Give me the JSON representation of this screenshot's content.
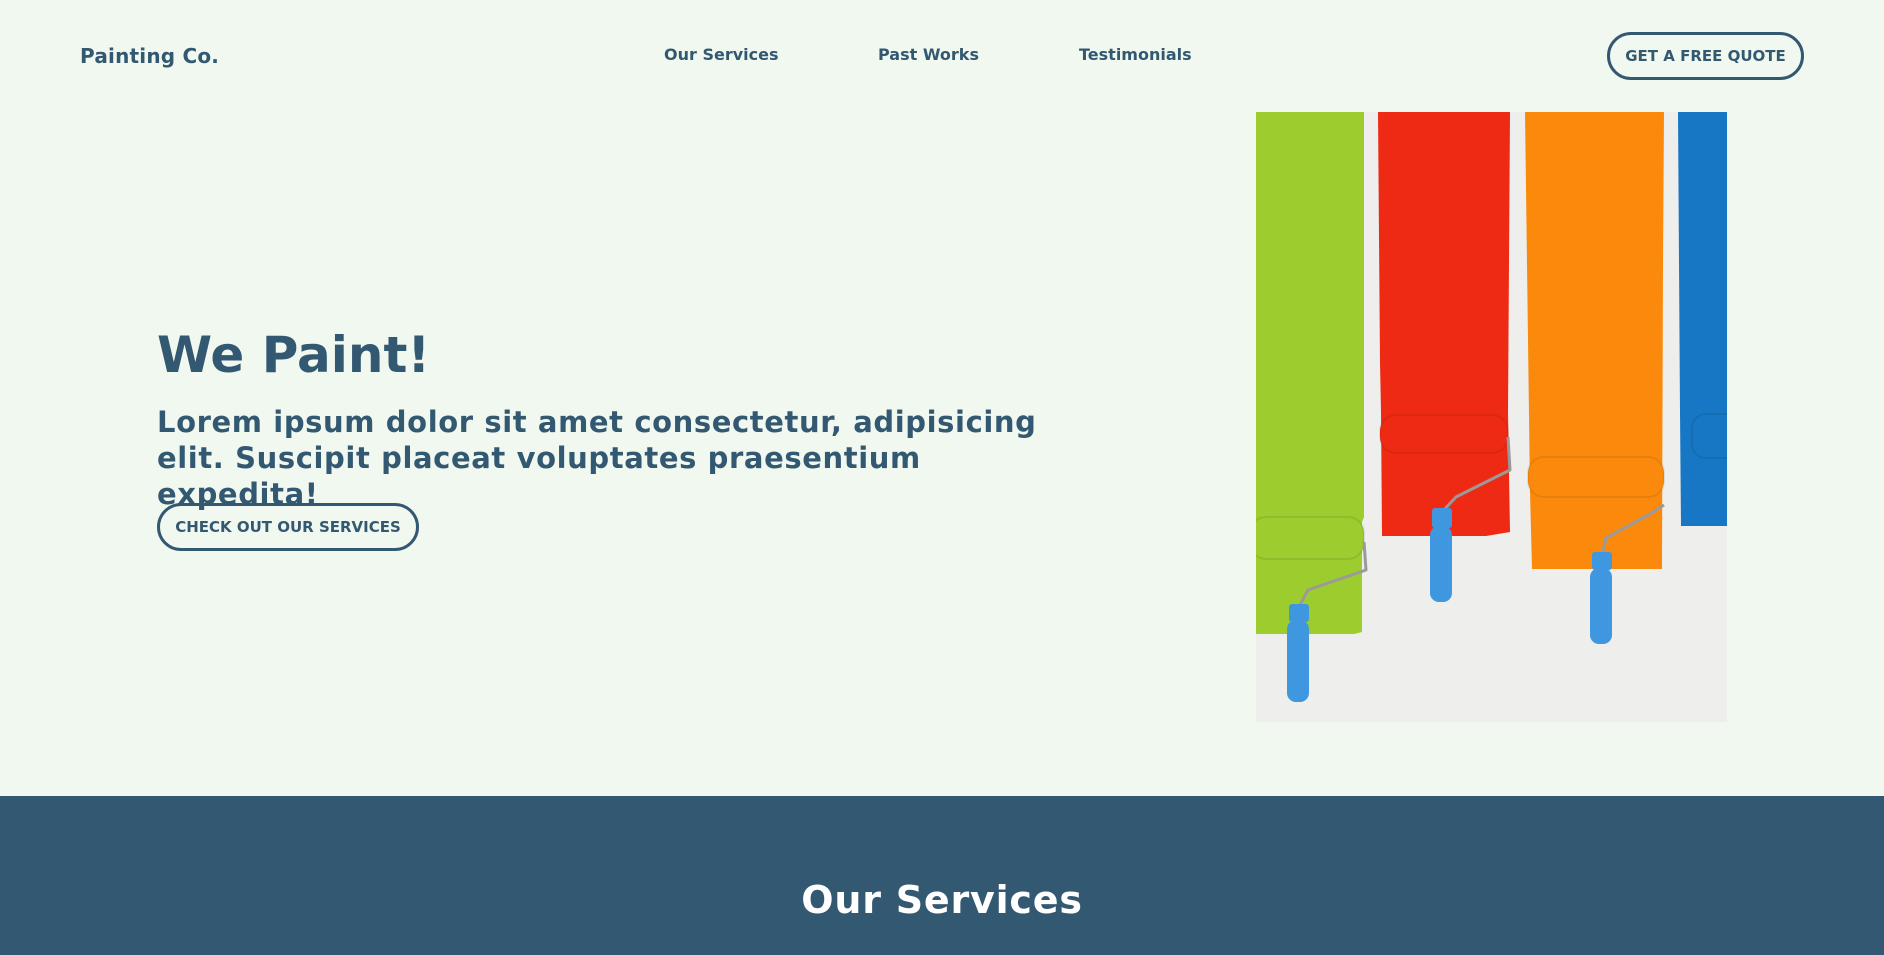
{
  "header": {
    "brand": "Painting Co.",
    "nav": [
      "Our Services",
      "Past Works",
      "Testimonials"
    ],
    "cta_label": "GET A FREE QUOTE"
  },
  "hero": {
    "title": "We Paint!",
    "subtitle": "Lorem ipsum dolor sit amet consectetur, adipisicing elit. Suscipit placeat voluptates praesentium expedita!",
    "cta_label": "CHECK OUT OUR SERVICES",
    "image": {
      "subject": "paint-rollers-on-wall",
      "stripe_colors": [
        "#9ccc2e",
        "#ee2a14",
        "#fb8a0c",
        "#1777c4"
      ],
      "roller_handle_color": "#3f98df"
    }
  },
  "services": {
    "heading": "Our Services"
  },
  "colors": {
    "page_background": "#f1f8ef",
    "primary": "#335872",
    "on_primary": "#ffffff"
  }
}
